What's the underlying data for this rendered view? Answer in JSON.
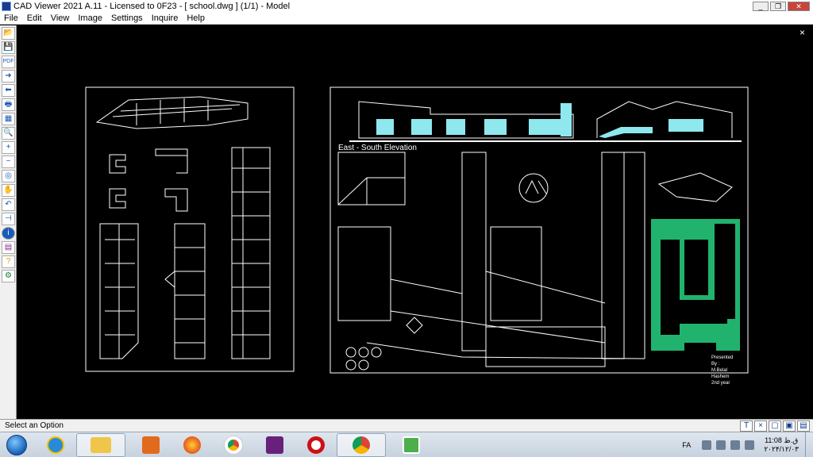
{
  "titlebar": {
    "title": "CAD Viewer 2021 A.11 - Licensed to 0F23  - [ school.dwg ] (1/1)  - Model",
    "minimize": "_",
    "restore": "❐",
    "close": "✕"
  },
  "menu": [
    "File",
    "Edit",
    "View",
    "Image",
    "Settings",
    "Inquire",
    "Help"
  ],
  "toolbar_icons": [
    "open-icon",
    "save-icon",
    "pdf-icon",
    "forward-arrow-icon",
    "back-arrow-icon",
    "print-icon",
    "layers-icon",
    "zoom-icon",
    "zoom-in-icon",
    "zoom-out-icon",
    "zoom-window-icon",
    "pan-icon",
    "undo-icon",
    "measure-icon",
    "info-icon",
    "book-icon",
    "help-icon",
    "settings-icon"
  ],
  "toolbar_glyphs": [
    "📂",
    "💾",
    "PDF",
    "➜",
    "⬅",
    "🖶",
    "▦",
    "🔍",
    "+",
    "−",
    "◎",
    "✋",
    "↶",
    "⊣",
    "i",
    "▤",
    "?",
    "⚙"
  ],
  "canvas": {
    "close": "×",
    "drawing_label": "East - South Elevation",
    "presented_by": [
      "Presented",
      "By :",
      "M.Belal",
      "Hashem",
      "2nd year"
    ]
  },
  "status": {
    "text": "Select an Option",
    "buttons": [
      "T",
      "×",
      "▢",
      "▣",
      "▤"
    ]
  },
  "taskbar": {
    "apps": [
      "explorer",
      "internet-explorer",
      "file-manager",
      "media-player",
      "firefox",
      "chrome",
      "visual-studio",
      "opera",
      "chrome-alt",
      "cad-viewer"
    ],
    "lang": "FA",
    "time": "11:08 ق.ظ",
    "date": "۲۰۲۴/۱۲/۰۳"
  },
  "colors": {
    "accent_cyan": "#8ee8ee",
    "green_block": "#21b36e",
    "line_white": "#ffffff"
  }
}
